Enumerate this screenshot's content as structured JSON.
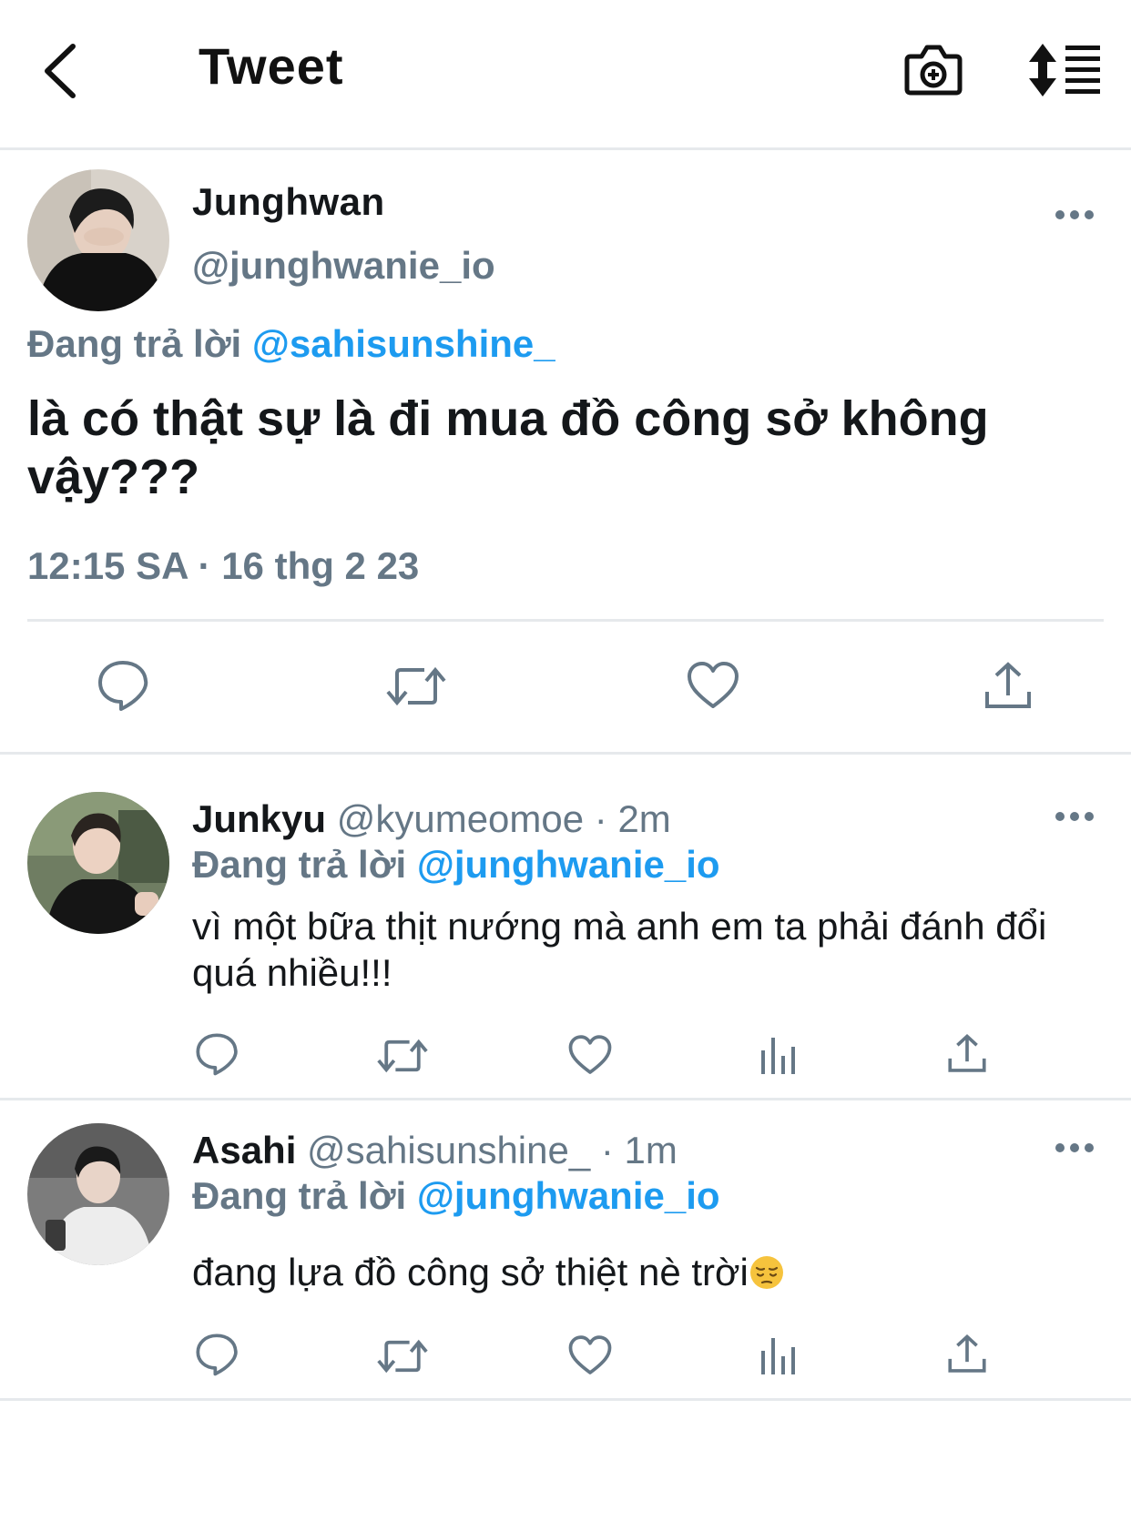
{
  "header": {
    "title": "Tweet"
  },
  "main_tweet": {
    "name": "Junghwan",
    "handle": "@junghwanie_io",
    "reply_prefix": "Đang trả lời",
    "reply_to": "@sahisunshine_",
    "text": "là có thật sự là đi mua đồ công sở không vậy???",
    "timestamp": "12:15 SA · 16 thg 2 23"
  },
  "replies": [
    {
      "name": "Junkyu",
      "handle": "@kyumeomoe",
      "time": "· 2m",
      "reply_prefix": "Đang trả lời",
      "reply_to": "@junghwanie_io",
      "text": "vì một bữa thịt nướng mà anh em ta phải đánh đổi quá nhiều!!!"
    },
    {
      "name": "Asahi",
      "handle": "@sahisunshine_",
      "time": "· 1m",
      "reply_prefix": "Đang trả lời",
      "reply_to": "@junghwanie_io",
      "text": "đang lựa đồ công sở thiệt nè trời",
      "emoji": "pensive-face"
    }
  ],
  "icons": {
    "back": "chevron-left-icon",
    "camera": "camera-plus-icon",
    "sort": "sort-icon",
    "more": "more-horizontal-icon",
    "reply": "reply-bubble-icon",
    "retweet": "retweet-icon",
    "like": "heart-icon",
    "views": "bar-chart-icon",
    "share": "share-icon"
  },
  "colors": {
    "link": "#1d9bf0",
    "muted": "#657786",
    "text": "#14171a",
    "divider": "#e6e9ec"
  }
}
